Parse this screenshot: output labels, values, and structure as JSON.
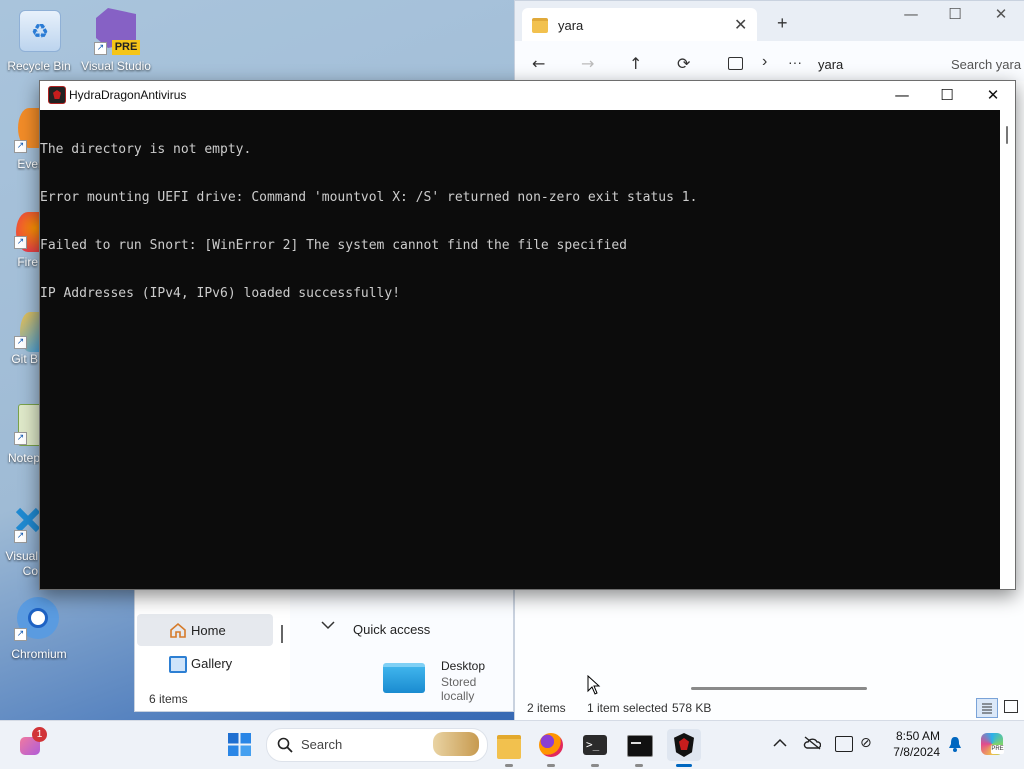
{
  "desktop": {
    "icons": [
      {
        "label": "Recycle Bin"
      },
      {
        "label": "Visual Studio",
        "badge": "PRE"
      },
      {
        "label": "Every"
      },
      {
        "label": "Fire"
      },
      {
        "label": "Git B"
      },
      {
        "label": "Notep"
      },
      {
        "label": "Visual",
        "label2": "Co"
      },
      {
        "label": "Chromium"
      }
    ]
  },
  "explorer_right": {
    "tab_title": "yara",
    "new_tab": "+",
    "address": "yara",
    "search_placeholder": "Search yara",
    "status": {
      "items": "2 items",
      "selected": "1 item selected",
      "size": "578 KB"
    },
    "nav": {
      "back": "←",
      "forward": "→",
      "up": "↑",
      "refresh": "⟳",
      "more": "···",
      "chevron": "›"
    }
  },
  "explorer_left": {
    "nav_items": [
      {
        "label": "Home"
      },
      {
        "label": "Gallery"
      }
    ],
    "section": "Quick access",
    "quick_item": {
      "name": "Desktop",
      "sub": "Stored locally"
    },
    "status": "6 items"
  },
  "console": {
    "title": "HydraDragonAntivirus",
    "lines": [
      "The directory is not empty.",
      "Error mounting UEFI drive: Command 'mountvol X: /S' returned non-zero exit status 1.",
      "Failed to run Snort: [WinError 2] The system cannot find the file specified",
      "IP Addresses (IPv4, IPv6) loaded successfully!"
    ]
  },
  "taskbar": {
    "search": "Search",
    "notification_count": "1",
    "time": "8:50 AM",
    "date": "7/8/2024"
  },
  "colors": {
    "accent": "#0067c0",
    "console_bg": "#0c0c0c",
    "console_text": "#cccccc",
    "folder": "#f2c14e"
  }
}
